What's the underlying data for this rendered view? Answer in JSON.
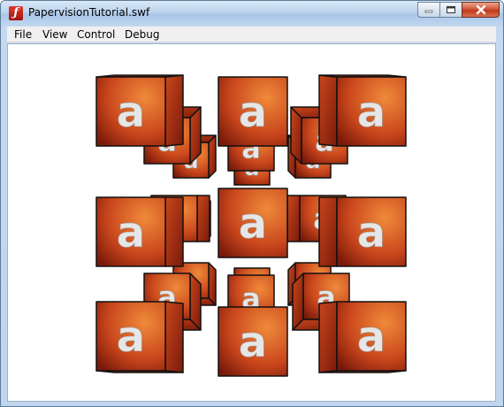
{
  "window": {
    "title": "PapervisionTutorial.swf"
  },
  "menu": [
    "File",
    "View",
    "Control",
    "Debug"
  ],
  "icons": {
    "app": "flash-player-icon",
    "minimize": "minimize-icon",
    "maximize": "maximize-icon",
    "close": "close-icon"
  },
  "scene": {
    "cube_glyph": "a",
    "colors": {
      "cube_light": "#ef8a3a",
      "cube_mid": "#c9461c",
      "cube_dark": "#7a1a0a",
      "glyph": "#e6e6e6"
    },
    "cube_count": 26
  }
}
